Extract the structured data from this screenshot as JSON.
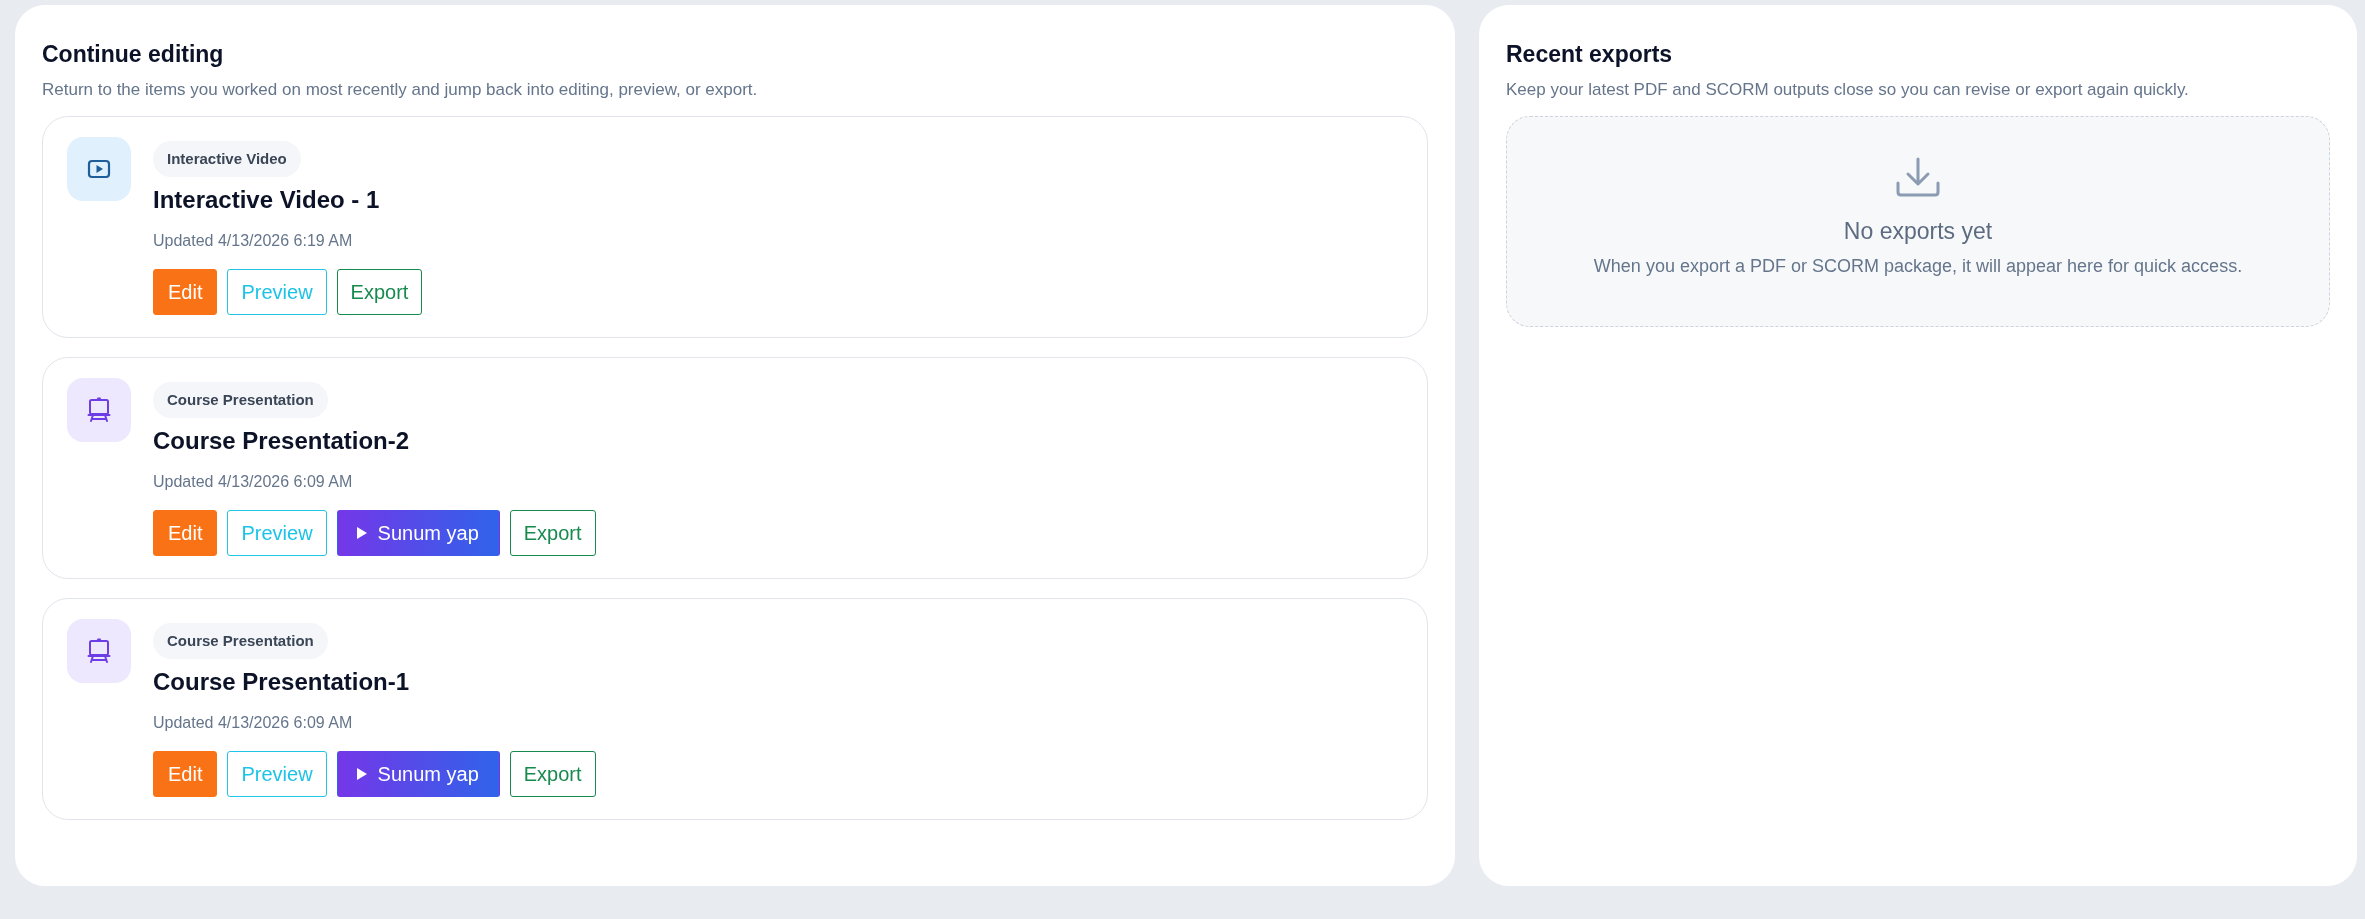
{
  "continue_editing": {
    "title": "Continue editing",
    "description": "Return to the items you worked on most recently and jump back into editing, preview, or export.",
    "items": [
      {
        "kind": "video",
        "badge": "Interactive Video",
        "title": "Interactive Video - 1",
        "updated": "Updated 4/13/2026 6:19 AM",
        "actions": [
          {
            "kind": "edit",
            "label": "Edit"
          },
          {
            "kind": "preview",
            "label": "Preview"
          },
          {
            "kind": "export",
            "label": "Export"
          }
        ]
      },
      {
        "kind": "presentation",
        "badge": "Course Presentation",
        "title": "Course Presentation-2",
        "updated": "Updated 4/13/2026 6:09 AM",
        "actions": [
          {
            "kind": "edit",
            "label": "Edit"
          },
          {
            "kind": "preview",
            "label": "Preview"
          },
          {
            "kind": "present",
            "label": "Sunum yap"
          },
          {
            "kind": "export",
            "label": "Export"
          }
        ]
      },
      {
        "kind": "presentation",
        "badge": "Course Presentation",
        "title": "Course Presentation-1",
        "updated": "Updated 4/13/2026 6:09 AM",
        "actions": [
          {
            "kind": "edit",
            "label": "Edit"
          },
          {
            "kind": "preview",
            "label": "Preview"
          },
          {
            "kind": "present",
            "label": "Sunum yap"
          },
          {
            "kind": "export",
            "label": "Export"
          }
        ]
      }
    ]
  },
  "recent_exports": {
    "title": "Recent exports",
    "description": "Keep your latest PDF and SCORM outputs close so you can revise or export again quickly.",
    "empty_state": {
      "title": "No exports yet",
      "message": "When you export a PDF or SCORM package, it will appear here for quick access."
    }
  }
}
